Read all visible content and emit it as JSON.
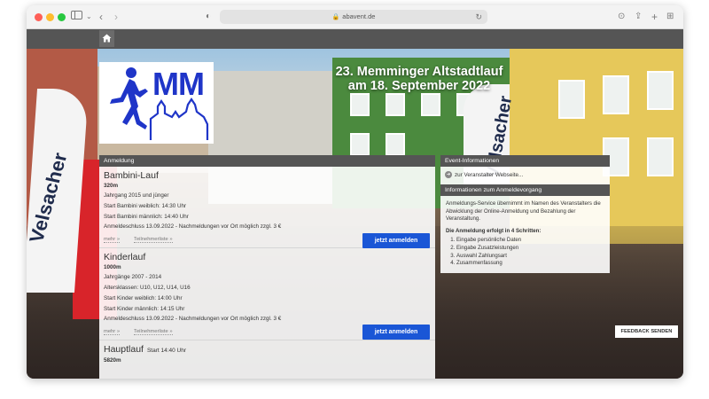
{
  "browser": {
    "url": "abavent.de"
  },
  "header": {
    "title_line1": "23. Memminger Altstadtlauf",
    "title_line2": "am 18. September 2022",
    "logo_text": "MM"
  },
  "background": {
    "banner_left_text": "Velsacher",
    "banner_right_text": "Velsacher"
  },
  "registration": {
    "header": "Anmeldung",
    "events": [
      {
        "title": "Bambini-Lauf",
        "subtitle": "",
        "distance": "320m",
        "lines": [
          "Jahrgang 2015 und jünger",
          "Start Bambini weiblich: 14:30 Uhr",
          "Start Bambini männlich: 14:40 Uhr",
          "Anmeldeschluss 13.09.2022 - Nachmeldungen vor Ort möglich zzgl. 3 €"
        ],
        "more_label": "mehr »",
        "participants_label": "Teilnehmerliste »",
        "button_label": "jetzt anmelden"
      },
      {
        "title": "Kinderlauf",
        "subtitle": "",
        "distance": "1000m",
        "lines": [
          "Jahrgänge 2007 - 2014",
          "Altersklassen: U10, U12, U14, U16",
          "Start Kinder weiblich: 14:00 Uhr",
          "Start Kinder männlich: 14:15 Uhr",
          "Anmeldeschluss 13.09.2022 - Nachmeldungen vor Ort möglich zzgl. 3 €"
        ],
        "more_label": "mehr »",
        "participants_label": "Teilnehmerliste »",
        "button_label": "jetzt anmelden"
      },
      {
        "title": "Hauptlauf",
        "subtitle": "Start 14:40 Uhr",
        "distance": "5820m"
      }
    ]
  },
  "event_info": {
    "header": "Event-Informationen",
    "organizer_link": "zur Veranstalter Webseite..."
  },
  "registration_info": {
    "header": "Informationen zum Anmeldevorgang",
    "intro": "Anmeldungs-Service übernimmt im Namen des Veranstalters die Abwicklung der Online-Anmeldung und Bezahlung der Veranstaltung.",
    "steps_title": "Die Anmeldung erfolgt in 4 Schritten:",
    "steps": [
      "Eingabe persönliche Daten",
      "Eingabe Zusatzleistungen",
      "Auswahl Zahlungsart",
      "Zusammenfassung"
    ]
  },
  "feedback_label": "FEEDBACK SENDEN"
}
